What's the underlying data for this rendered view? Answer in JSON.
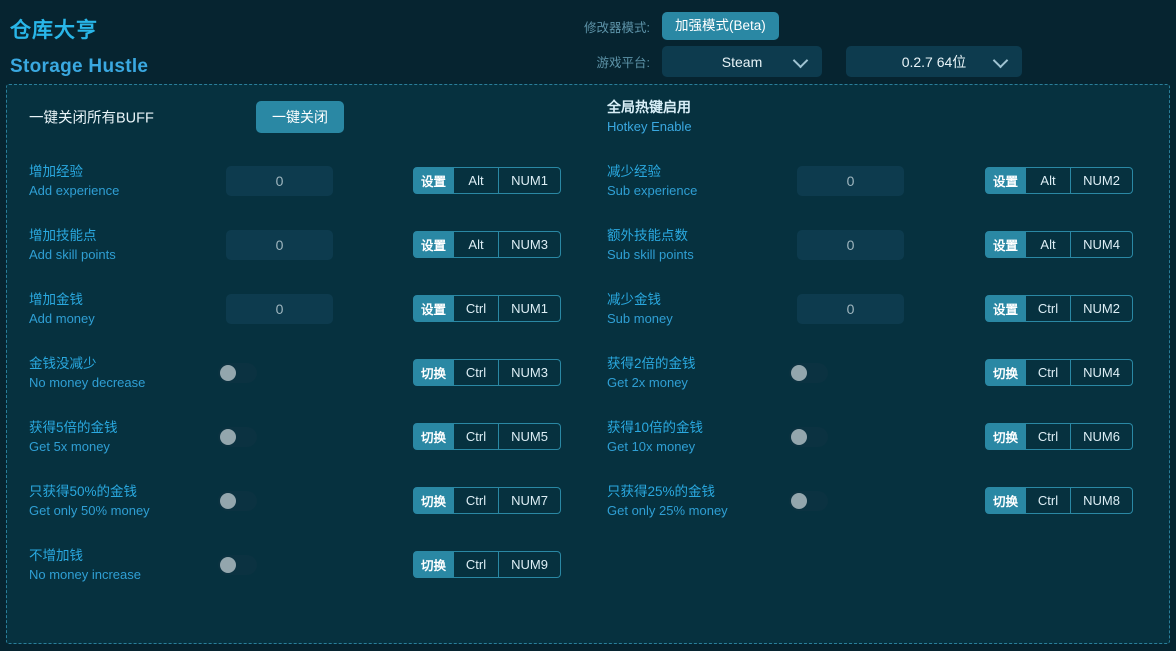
{
  "header": {
    "title_cn": "仓库大亨",
    "title_en": "Storage Hustle",
    "mode_label": "修改器模式:",
    "mode_value": "加强模式(Beta)",
    "platform_label": "游戏平台:",
    "platform_value": "Steam",
    "version_value": "0.2.7 64位",
    "accent_color": "#2a88a4",
    "title_color": "#29b6e8"
  },
  "top": {
    "buff_label": "一键关闭所有BUFF",
    "buff_button": "一键关闭",
    "hotkey_enable_cn": "全局热键启用",
    "hotkey_enable_en": "Hotkey Enable",
    "hotkey_enable_state": "on"
  },
  "left_rows": [
    {
      "name_cn": "增加经验",
      "name_en": "Add experience",
      "control": "input",
      "value": "0",
      "action": "设置",
      "mod": "Alt",
      "key": "NUM1"
    },
    {
      "name_cn": "增加技能点",
      "name_en": "Add skill points",
      "control": "input",
      "value": "0",
      "action": "设置",
      "mod": "Alt",
      "key": "NUM3"
    },
    {
      "name_cn": "增加金钱",
      "name_en": "Add money",
      "control": "input",
      "value": "0",
      "action": "设置",
      "mod": "Ctrl",
      "key": "NUM1"
    },
    {
      "name_cn": "金钱没减少",
      "name_en": "No money decrease",
      "control": "switch",
      "state": "off",
      "action": "切换",
      "mod": "Ctrl",
      "key": "NUM3"
    },
    {
      "name_cn": "获得5倍的金钱",
      "name_en": "Get 5x money",
      "control": "switch",
      "state": "off",
      "action": "切换",
      "mod": "Ctrl",
      "key": "NUM5"
    },
    {
      "name_cn": "只获得50%的金钱",
      "name_en": "Get only 50% money",
      "control": "switch",
      "state": "off",
      "action": "切换",
      "mod": "Ctrl",
      "key": "NUM7"
    },
    {
      "name_cn": "不增加钱",
      "name_en": "No money increase",
      "control": "switch",
      "state": "off",
      "action": "切换",
      "mod": "Ctrl",
      "key": "NUM9"
    }
  ],
  "right_rows": [
    {
      "name_cn": "减少经验",
      "name_en": "Sub experience",
      "control": "input",
      "value": "0",
      "action": "设置",
      "mod": "Alt",
      "key": "NUM2"
    },
    {
      "name_cn": "额外技能点数",
      "name_en": "Sub skill points",
      "control": "input",
      "value": "0",
      "action": "设置",
      "mod": "Alt",
      "key": "NUM4"
    },
    {
      "name_cn": "减少金钱",
      "name_en": "Sub money",
      "control": "input",
      "value": "0",
      "action": "设置",
      "mod": "Ctrl",
      "key": "NUM2"
    },
    {
      "name_cn": "获得2倍的金钱",
      "name_en": "Get 2x money",
      "control": "switch",
      "state": "off",
      "action": "切换",
      "mod": "Ctrl",
      "key": "NUM4"
    },
    {
      "name_cn": "获得10倍的金钱",
      "name_en": "Get 10x money",
      "control": "switch",
      "state": "off",
      "action": "切换",
      "mod": "Ctrl",
      "key": "NUM6"
    },
    {
      "name_cn": "只获得25%的金钱",
      "name_en": "Get only 25% money",
      "control": "switch",
      "state": "off",
      "action": "切换",
      "mod": "Ctrl",
      "key": "NUM8"
    }
  ]
}
